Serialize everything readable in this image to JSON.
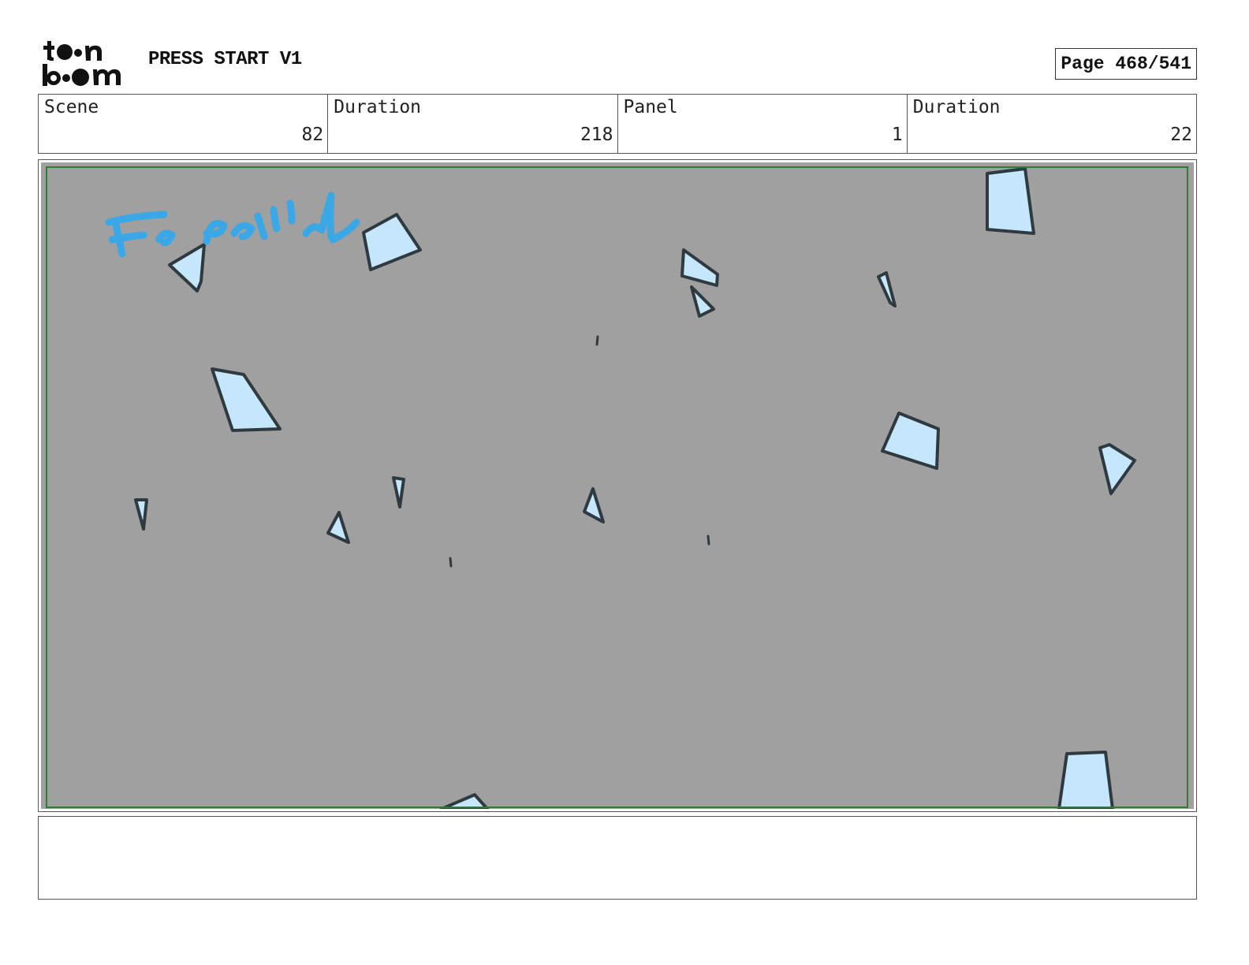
{
  "header": {
    "project_title": "PRESS START V1",
    "page_label": "Page",
    "page_number": "468/541",
    "logo_text": "toonboom"
  },
  "info": [
    {
      "label": "Scene",
      "value": "82"
    },
    {
      "label": "Duration",
      "value": "218"
    },
    {
      "label": "Panel",
      "value": "1"
    },
    {
      "label": "Duration",
      "value": "22"
    }
  ],
  "panel": {
    "background_color": "#a0a0a0",
    "safe_frame_color": "#2e7d32",
    "shard_fill": "#c6e6fb",
    "shard_stroke": "#2f3a40",
    "note_color": "#3aa7e6",
    "handwritten_note": "Fx particles"
  },
  "caption": {
    "text": ""
  }
}
